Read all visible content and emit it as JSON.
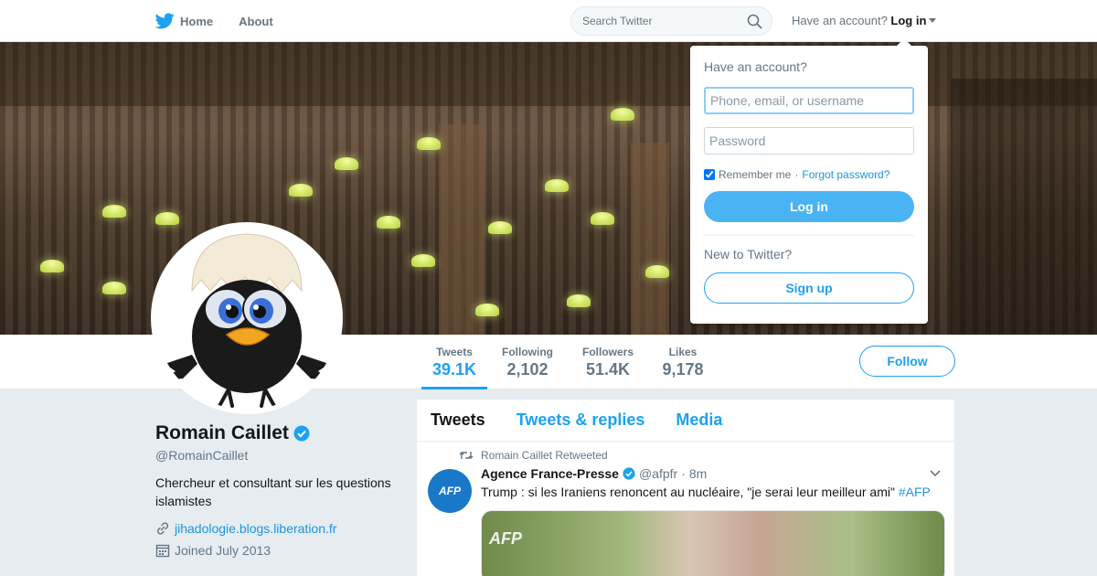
{
  "nav": {
    "home_label": "Home",
    "about_label": "About",
    "search_placeholder": "Search Twitter",
    "have_account": "Have an account?",
    "login_label": "Log in"
  },
  "login_dropdown": {
    "title": "Have an account?",
    "username_placeholder": "Phone, email, or username",
    "password_placeholder": "Password",
    "remember_label": "Remember me",
    "separator": "·",
    "forgot_label": "Forgot password?",
    "login_button": "Log in",
    "new_label": "New to Twitter?",
    "signup_button": "Sign up"
  },
  "profile": {
    "name": "Romain Caillet",
    "handle": "@RomainCaillet",
    "bio": "Chercheur et consultant sur les questions islamistes",
    "link": "jihadologie.blogs.liberation.fr",
    "joined": "Joined July 2013",
    "follow_button": "Follow"
  },
  "stats": [
    {
      "label": "Tweets",
      "value": "39.1K"
    },
    {
      "label": "Following",
      "value": "2,102"
    },
    {
      "label": "Followers",
      "value": "51.4K"
    },
    {
      "label": "Likes",
      "value": "9,178"
    }
  ],
  "timeline": {
    "tabs": [
      "Tweets",
      "Tweets & replies",
      "Media"
    ],
    "tweet": {
      "retweet_context": "Romain Caillet Retweeted",
      "author_name": "Agence France-Presse",
      "author_handle": "@afpfr",
      "dot": "·",
      "time": "8m",
      "avatar_text": "AFP",
      "text": "Trump : si les Iraniens renoncent au nucléaire, \"je serai leur meilleur ami\"",
      "hashtag": "#AFP",
      "media_logo": "AFP"
    }
  },
  "colors": {
    "accent": "#1da1f2",
    "link": "#1b95e0",
    "login_button": "#4ab3f4"
  }
}
